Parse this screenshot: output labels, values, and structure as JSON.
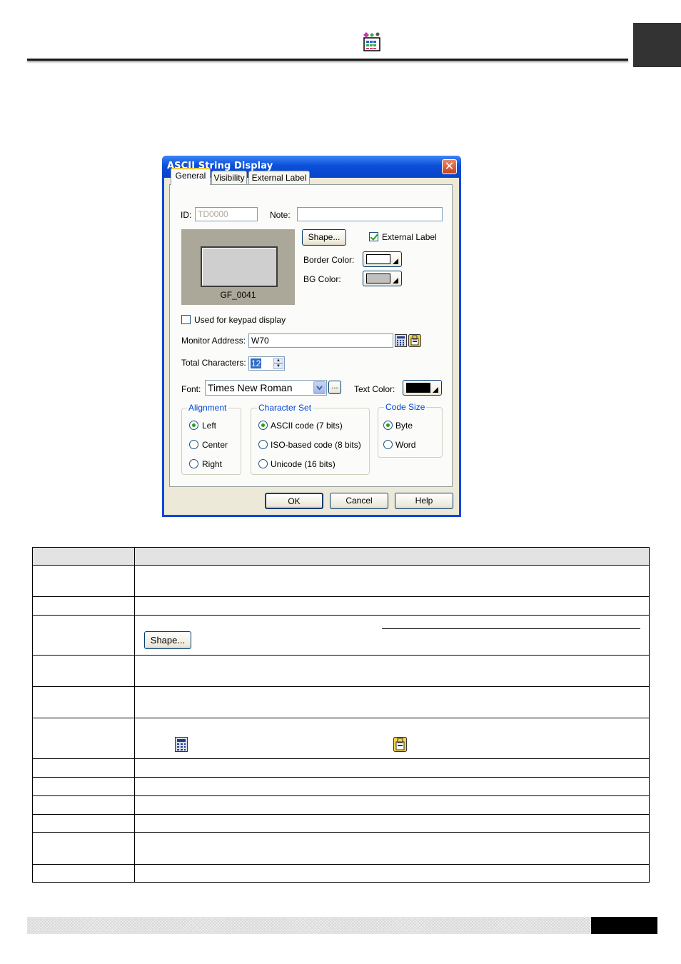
{
  "dialog": {
    "title": "ASCII String Display",
    "close_glyph": "✕",
    "tabs": [
      {
        "label": "General",
        "active": true
      },
      {
        "label": "Visibility",
        "active": false
      },
      {
        "label": "External Label",
        "active": false
      }
    ],
    "id_label": "ID:",
    "id_value": "TD0000",
    "note_label": "Note:",
    "note_value": "",
    "shape_button": "Shape...",
    "external_label_checkbox": {
      "label": "External Label",
      "checked": true
    },
    "border_color_label": "Border Color:",
    "border_color": "#ffffff",
    "bg_color_label": "BG Color:",
    "bg_color": "#c0c0c0",
    "preview_label": "GF_0041",
    "keypad_checkbox": {
      "label": "Used for keypad display",
      "checked": false
    },
    "monitor_address_label": "Monitor Address:",
    "monitor_address_value": "W70",
    "total_characters_label": "Total Characters:",
    "total_characters_value": "12",
    "font_label": "Font:",
    "font_value": "Times New Roman",
    "font_more_button": "...",
    "text_color_label": "Text Color:",
    "text_color": "#000000",
    "alignment": {
      "title": "Alignment",
      "options": [
        "Left",
        "Center",
        "Right"
      ],
      "selected": "Left"
    },
    "character_set": {
      "title": "Character Set",
      "options": [
        "ASCII code (7 bits)",
        "ISO-based code (8 bits)",
        "Unicode (16 bits)"
      ],
      "selected": "ASCII code (7 bits)"
    },
    "code_size": {
      "title": "Code Size",
      "options": [
        "Byte",
        "Word"
      ],
      "selected": "Byte"
    },
    "ok_button": "OK",
    "cancel_button": "Cancel",
    "help_button": "Help"
  },
  "table": {
    "shape_button_label": "Shape..."
  },
  "colors": {
    "titlebar": "#0b4fd9",
    "dialog_face": "#ece9d8",
    "group_title": "#0046d5"
  }
}
